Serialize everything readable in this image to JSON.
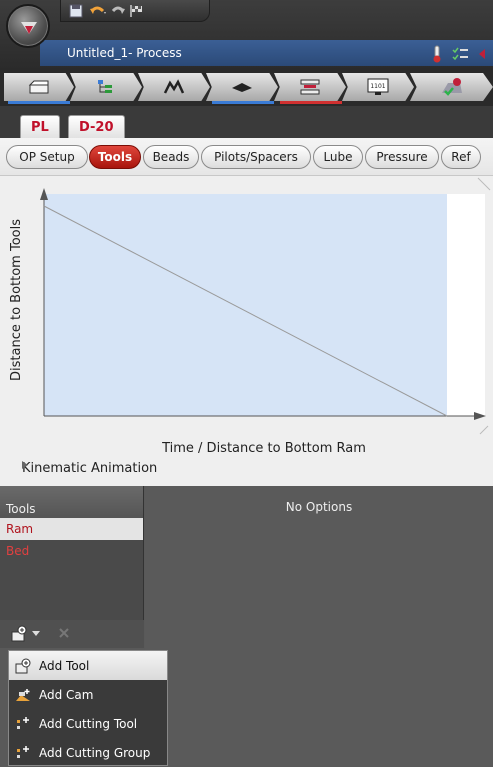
{
  "window": {
    "process_title": "Untitled_1- Process"
  },
  "quick_access": {
    "icons": [
      "save-icon",
      "undo-icon",
      "redo-icon",
      "flag-icon"
    ]
  },
  "steps": [
    {
      "icon": "die-block-icon",
      "underline": "#3a7bd5"
    },
    {
      "icon": "tool-tree-icon",
      "underline": ""
    },
    {
      "icon": "profile-shape-icon",
      "underline": ""
    },
    {
      "icon": "blank-sheet-icon",
      "underline": "#3a7bd5"
    },
    {
      "icon": "press-setup-icon",
      "underline": "#d03030"
    },
    {
      "icon": "monitor-icon",
      "underline": ""
    },
    {
      "icon": "run-check-icon",
      "underline": ""
    }
  ],
  "monitor_text": "1101",
  "pl_tabs": [
    {
      "label": "PL"
    },
    {
      "label": "D-20"
    }
  ],
  "pills": [
    {
      "label": "OP Setup",
      "active": false
    },
    {
      "label": "Tools",
      "active": true
    },
    {
      "label": "Beads",
      "active": false
    },
    {
      "label": "Pilots/Spacers",
      "active": false
    },
    {
      "label": "Lube",
      "active": false
    },
    {
      "label": "Pressure",
      "active": false
    },
    {
      "label": "Ref",
      "active": false
    }
  ],
  "chart_data": {
    "type": "line",
    "xlabel": "Time / Distance to Bottom Ram",
    "ylabel": "Distance to Bottom Tools",
    "series": [
      {
        "x": [
          0,
          1
        ],
        "y": [
          1,
          0
        ]
      }
    ],
    "xlim": [
      0,
      1
    ],
    "ylim": [
      0,
      1
    ],
    "grid": false,
    "plot_bg": "#d6e4f6"
  },
  "animation": {
    "label": "Kinematic Animation"
  },
  "tools_panel": {
    "header": "Tools",
    "items": [
      {
        "label": "Ram",
        "selected": true
      },
      {
        "label": "Bed",
        "selected": false
      }
    ]
  },
  "options_panel": {
    "text": "No Options"
  },
  "add_menu": {
    "items": [
      {
        "label": "Add Tool",
        "icon": "add-tool-icon"
      },
      {
        "label": "Add Cam",
        "icon": "add-cam-icon"
      },
      {
        "label": "Add Cutting Tool",
        "icon": "add-cutting-tool-icon"
      },
      {
        "label": "Add Cutting Group",
        "icon": "add-cutting-group-icon"
      }
    ]
  }
}
